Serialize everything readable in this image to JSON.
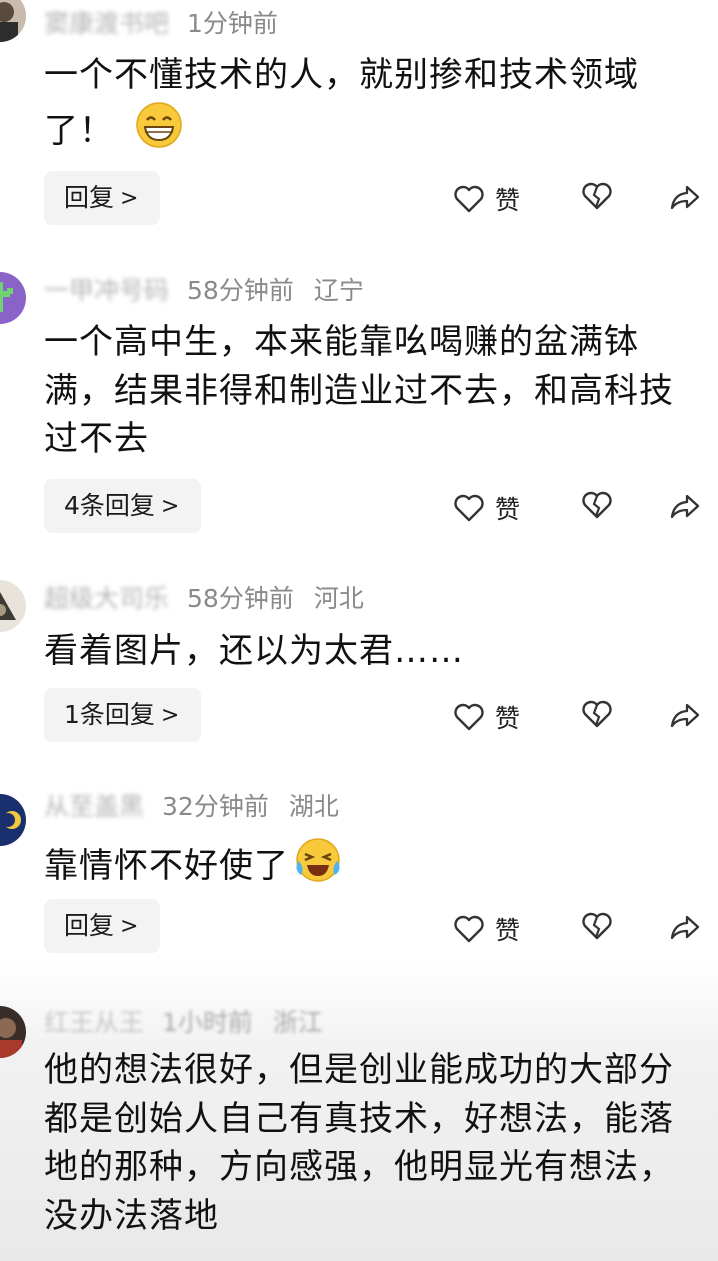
{
  "comments": [
    {
      "username": "窦康渡书吧",
      "time": "1分钟前",
      "location": "",
      "text": "一个不懂技术的人，就别掺和技术领域了！",
      "emoji": "grinning-face-emoji",
      "reply_label": "回复",
      "like_label": "赞"
    },
    {
      "username": "一甲冲号码",
      "time": "58分钟前",
      "location": "辽宁",
      "text": "一个高中生，本来能靠吆喝赚的盆满钵满，结果非得和制造业过不去，和高科技过不去",
      "reply_label": "4条回复",
      "like_label": "赞"
    },
    {
      "username": "超级大司乐",
      "time": "58分钟前",
      "location": "河北",
      "text": "看着图片，还以为太君……",
      "reply_label": "1条回复",
      "like_label": "赞"
    },
    {
      "username": "从至盖黑",
      "time": "32分钟前",
      "location": "湖北",
      "text": "靠情怀不好使了",
      "emoji": "laughing-crying-emoji",
      "reply_label": "回复",
      "like_label": "赞"
    },
    {
      "username": "红王从王",
      "time": "1小时前",
      "location": "浙江",
      "text": "他的想法很好，但是创业能成功的大部分都是创始人自己有真技术，好想法，能落地的那种，方向感强，他明显光有想法，没办法落地"
    }
  ],
  "icons": {
    "like": "heart-outline-icon",
    "dislike": "broken-heart-icon",
    "share": "share-arrow-icon",
    "chevron": "chevron-right-icon"
  },
  "colors": {
    "meta": "#8a8a8a",
    "text": "#111111",
    "reply_bg": "#f3f3f3",
    "icon": "#333333"
  }
}
